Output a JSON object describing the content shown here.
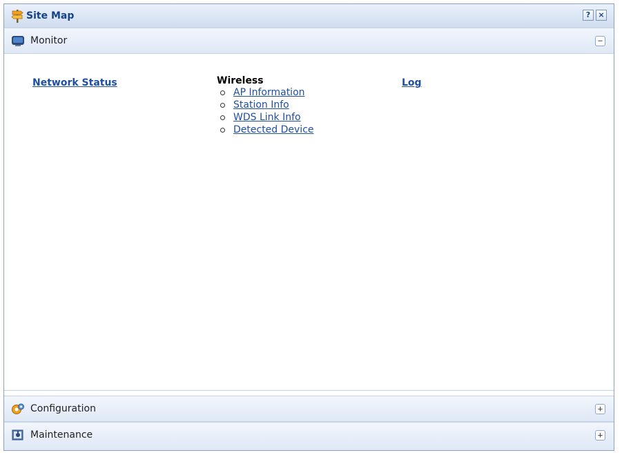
{
  "window": {
    "title": "Site Map",
    "help_label": "?",
    "close_label": "×"
  },
  "sections": {
    "monitor": {
      "label": "Monitor",
      "toggle": "−"
    },
    "configuration": {
      "label": "Configuration",
      "toggle": "+"
    },
    "maintenance": {
      "label": "Maintenance",
      "toggle": "+"
    }
  },
  "monitor_content": {
    "network_status": "Network Status",
    "wireless": {
      "heading": "Wireless",
      "items": [
        "AP Information",
        "Station Info",
        "WDS Link Info",
        "Detected Device"
      ]
    },
    "log": "Log"
  },
  "colors": {
    "title": "#15428b",
    "link": "#1f4fa1",
    "header_bg": "#dfe8f5"
  }
}
